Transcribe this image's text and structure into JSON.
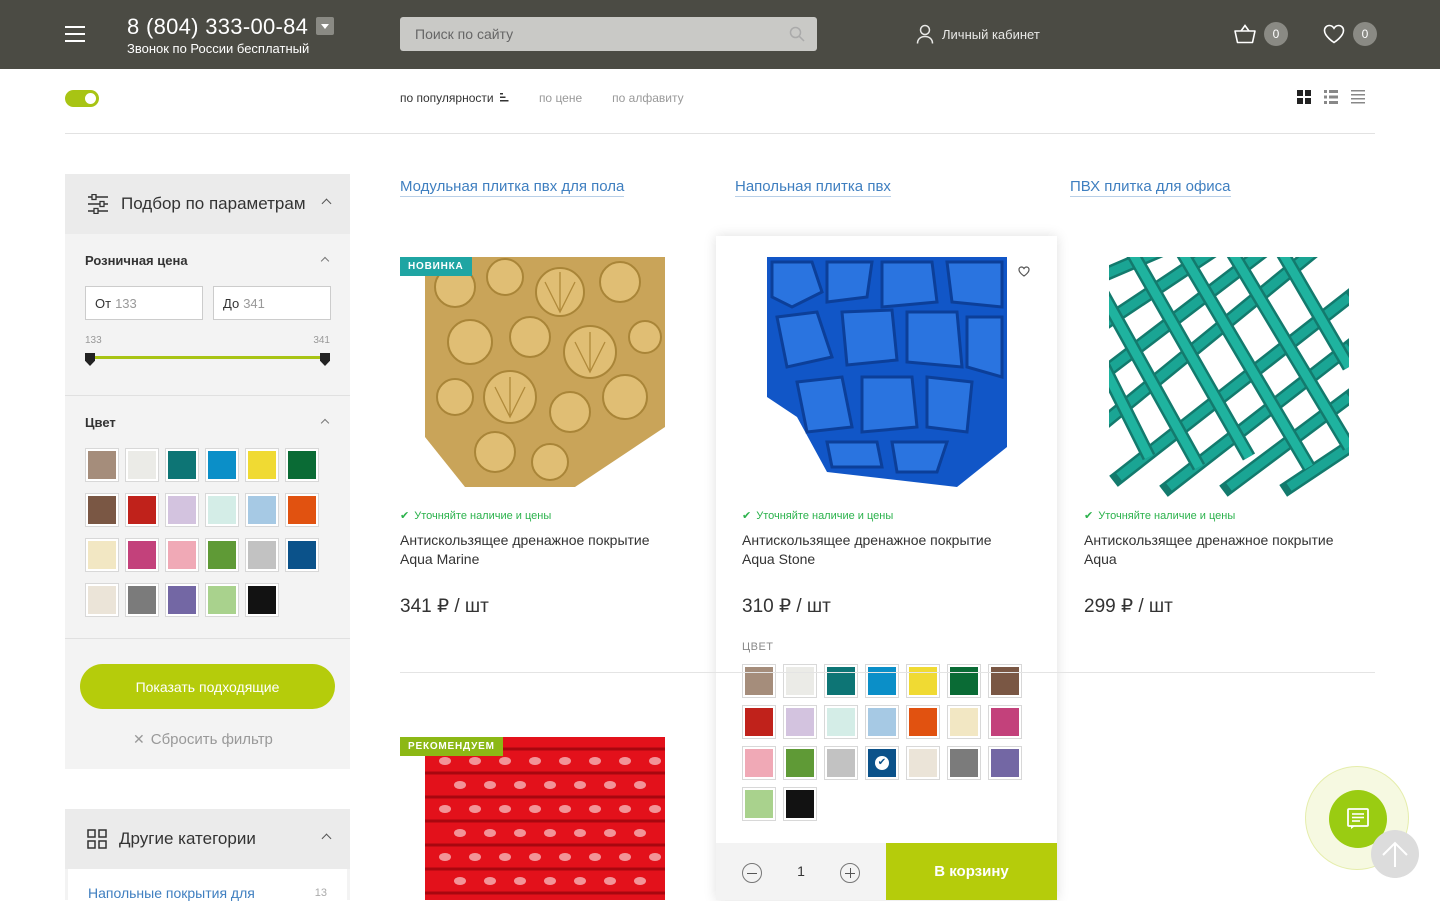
{
  "header": {
    "phone": "8 (804) 333-00-84",
    "phone_sub": "Звонок по России бесплатный",
    "search_placeholder": "Поиск по сайту",
    "account_label": "Личный кабинет",
    "cart_count": "0",
    "fav_count": "0"
  },
  "toolbar": {
    "sorts": [
      "по популярности",
      "по цене",
      "по алфавиту"
    ]
  },
  "filter": {
    "title": "Подбор по параметрам",
    "price_title": "Розничная цена",
    "from_prefix": "От",
    "from_value": "133",
    "to_prefix": "До",
    "to_value": "341",
    "range_min": "133",
    "range_max": "341",
    "color_title": "Цвет",
    "colors": [
      "#a58d7b",
      "#ebebe7",
      "#0d7575",
      "#0b8fc8",
      "#f0da33",
      "#0a6b35",
      "#7a5744",
      "#c0221b",
      "#d3c3df",
      "#d4ede7",
      "#a6c9e4",
      "#e15210",
      "#f2e7c3",
      "#c3417b",
      "#f0a9b6",
      "#5f9a36",
      "#c2c2c2",
      "#0b528a",
      "#ebe4d8",
      "#7b7b7b",
      "#7367a4",
      "#a9d28d",
      "#121212"
    ],
    "show_button": "Показать подходящие",
    "reset_label": "Сбросить фильтр"
  },
  "categories": {
    "title": "Другие категории",
    "item_label": "Напольные покрытия для",
    "item_count": "13"
  },
  "tags": [
    "Модульная плитка пвх для пола",
    "Напольная плитка пвх",
    "ПВХ плитка для офиса"
  ],
  "products": [
    {
      "label": "НОВИНКА",
      "avail": "Уточняйте наличие и цены",
      "name": "Антискользящее дренажное покрытие Aqua Marine",
      "price": "341 ₽ / шт"
    },
    {
      "avail": "Уточняйте наличие и цены",
      "name": "Антискользящее дренажное покрытие Aqua Stone",
      "price": "310 ₽ / шт"
    },
    {
      "avail": "Уточняйте наличие и цены",
      "name": "Антискользящее дренажное покрытие Aqua",
      "price": "299 ₽ / шт"
    },
    {
      "label": "РЕКОМЕНДУЕМ"
    }
  ],
  "hover": {
    "color_label": "ЦВЕТ",
    "colors": [
      "#a58d7b",
      "#ebebe7",
      "#0d7575",
      "#0b8fc8",
      "#f0da33",
      "#0a6b35",
      "#7a5744",
      "#c0221b",
      "#d3c3df",
      "#d4ede7",
      "#a6c9e4",
      "#e15210",
      "#f2e7c3",
      "#c3417b",
      "#f0a9b6",
      "#5f9a36",
      "#c2c2c2",
      "#0b528a",
      "#ebe4d8",
      "#7b7b7b",
      "#7367a4",
      "#a9d28d",
      "#121212"
    ],
    "selected_index": 17,
    "qty": "1",
    "cart_button": "В корзину"
  },
  "icons": {
    "menu": "burger-icon",
    "search": "search-icon",
    "user": "user-icon",
    "cart": "basket-icon",
    "fav": "heart-icon",
    "chat": "chat-icon",
    "totop": "arrow-up-icon"
  }
}
